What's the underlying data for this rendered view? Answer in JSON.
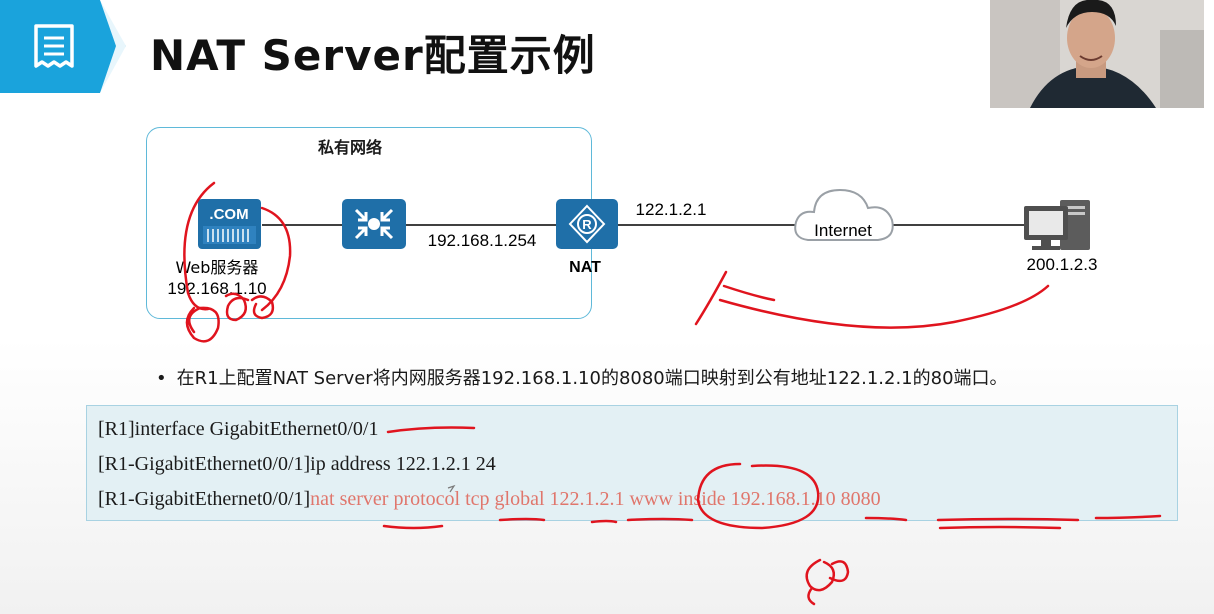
{
  "slide": {
    "title": "NAT Server配置示例",
    "icon": "document-list-icon",
    "accent_color": "#1aa3dc"
  },
  "diagram": {
    "private_network_label": "私有网络",
    "web_server": {
      "icon": "web-server-icon",
      "badge": ".COM",
      "name": "Web服务器",
      "ip": "192.168.1.10"
    },
    "switch": {
      "icon": "switch-icon",
      "ip": "192.168.1.254"
    },
    "router": {
      "icon": "router-icon",
      "name": "NAT",
      "public_ip": "122.1.2.1"
    },
    "internet": {
      "icon": "cloud-icon",
      "label": "Internet"
    },
    "client": {
      "icon": "pc-icon",
      "ip": "200.1.2.3"
    },
    "node_color": "#1f6fa8"
  },
  "bullet": "在R1上配置NAT Server将内网服务器192.168.1.10的8080端口映射到公有地址122.1.2.1的80端口。",
  "code": {
    "line1": "[R1]interface GigabitEthernet0/0/1",
    "line2": "[R1-GigabitEthernet0/0/1]ip address 122.1.2.1 24",
    "line3_prefix": "[R1-GigabitEthernet0/0/1]",
    "line3_command": "nat server protocol tcp global 122.1.2.1  www inside 192.168.1.10 8080",
    "highlight_color": "#e0766c"
  },
  "annotation_color": "#e0141e"
}
